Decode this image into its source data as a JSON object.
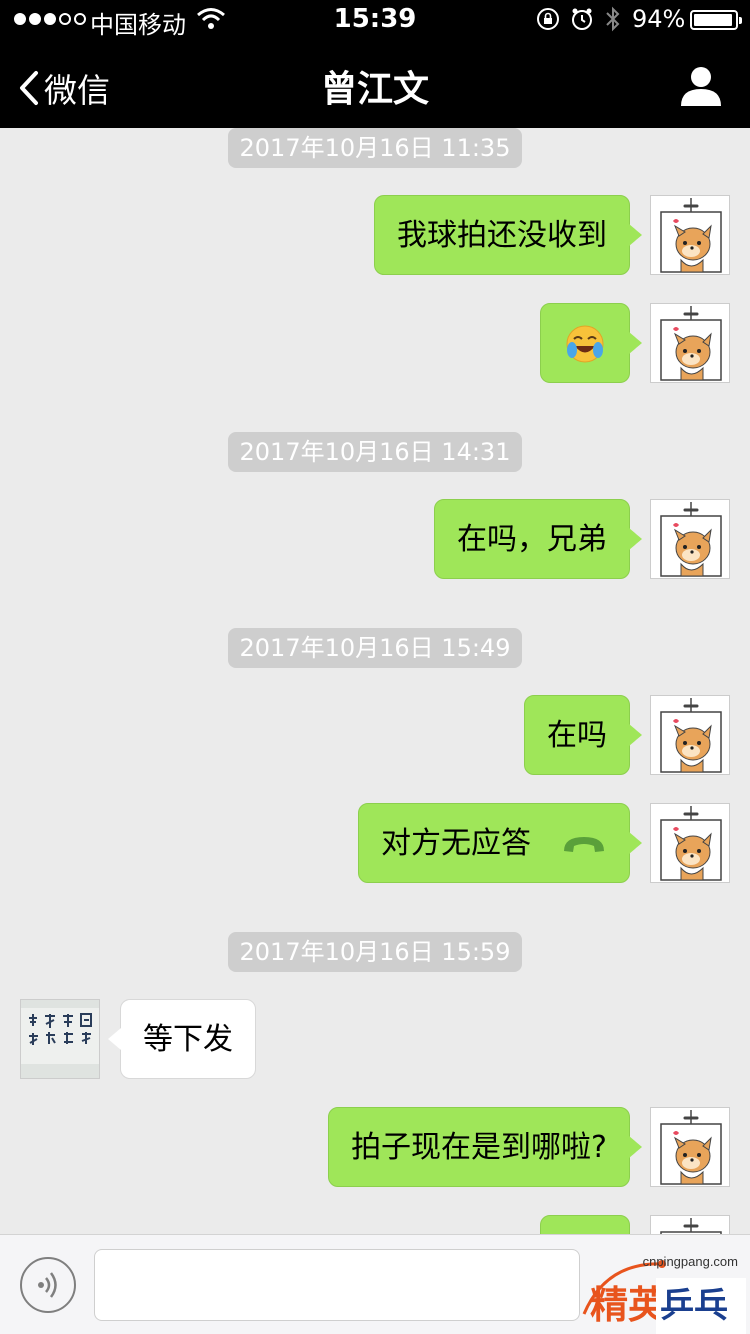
{
  "status_bar": {
    "carrier": "中国移动",
    "time": "15:39",
    "battery_percent": "94%",
    "battery_level": 0.94,
    "signal_bars_filled": 3,
    "signal_bars_total": 5
  },
  "nav": {
    "back_label": "微信",
    "title": "曾江文",
    "back_icon": "chevron-left-icon",
    "profile_icon": "person-icon"
  },
  "chat": {
    "timestamps": [
      "2017年10月16日 11:35",
      "2017年10月16日 14:31",
      "2017年10月16日 15:49",
      "2017年10月16日 15:59"
    ],
    "messages": [
      {
        "sender": "me",
        "text": "我球拍还没收到"
      },
      {
        "sender": "me",
        "emoji": "face-with-tears-of-joy"
      },
      {
        "sender": "me",
        "text": "在吗，兄弟"
      },
      {
        "sender": "me",
        "text": "在吗"
      },
      {
        "sender": "me",
        "text": "对方无应答",
        "icon": "phone-hangup-icon"
      },
      {
        "sender": "them",
        "text": "等下发"
      },
      {
        "sender": "me",
        "text": "拍子现在是到哪啦?"
      }
    ]
  },
  "input_bar": {
    "voice_icon": "voice-icon",
    "text_value": ""
  },
  "watermark": {
    "url": "cnpingpang.com",
    "brand_part1": "精英",
    "brand_part2": "乒乓网"
  },
  "colors": {
    "my_bubble": "#9fe659",
    "their_bubble": "#ffffff",
    "chat_background": "#ebebeb",
    "top_bar": "#000000",
    "timestamp_bg": "#cecece"
  }
}
